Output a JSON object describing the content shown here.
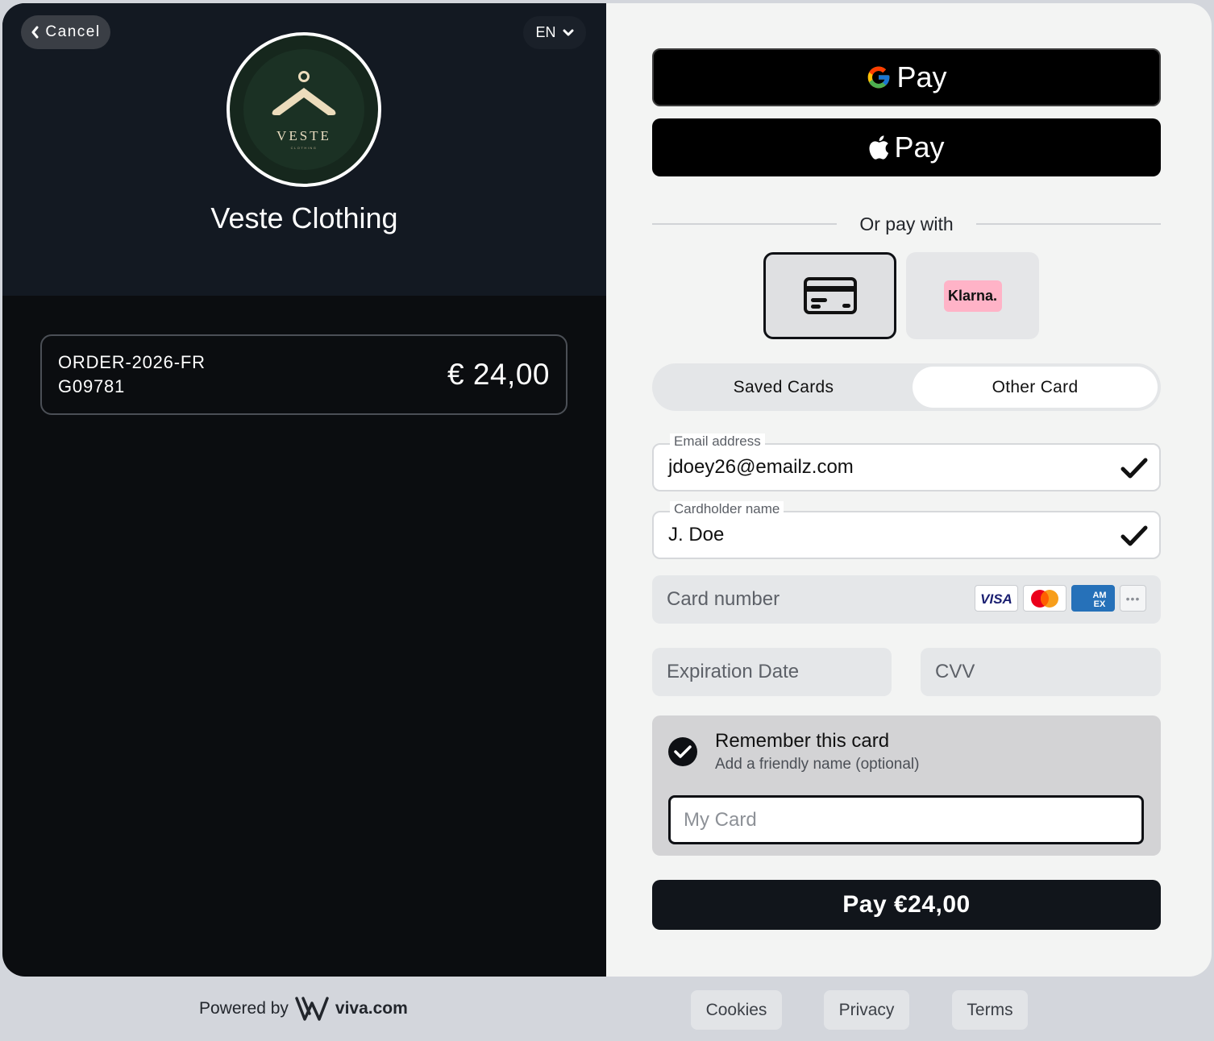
{
  "header": {
    "cancel_label": "Cancel",
    "language": "EN"
  },
  "merchant": {
    "logo_word": "VESTE",
    "logo_sub": "CLOTHING",
    "name": "Veste Clothing"
  },
  "order": {
    "id": "ORDER-2026-FRG09781",
    "amount": "€ 24,00"
  },
  "wallets": {
    "google_pay_label": "Pay",
    "apple_pay_label": "Pay"
  },
  "divider_text": "Or pay with",
  "methods": {
    "klarna_label": "Klarna."
  },
  "tabs": {
    "saved": "Saved Cards",
    "other": "Other Card"
  },
  "form": {
    "email_label": "Email address",
    "email_value": "jdoey26@emailz.com",
    "name_label": "Cardholder name",
    "name_value": "J. Doe",
    "card_number_placeholder": "Card number",
    "expiration_placeholder": "Expiration Date",
    "cvv_placeholder": "CVV",
    "brands": [
      "VISA",
      "Mastercard",
      "AMEX",
      "more"
    ]
  },
  "remember": {
    "title": "Remember this card",
    "subtitle": "Add a friendly name (optional)",
    "placeholder": "My Card",
    "checked": true
  },
  "pay_button": "Pay €24,00",
  "footer": {
    "powered_by": "Powered by",
    "brand": "viva.com",
    "links": [
      "Cookies",
      "Privacy",
      "Terms"
    ]
  },
  "colors": {
    "left_panel": "#0b0d10",
    "left_header": "#131922",
    "right_panel": "#f3f4f3",
    "logo_bg": "#1b3124",
    "klarna_pink": "#ffb3c7",
    "pay_button": "#11151b"
  }
}
